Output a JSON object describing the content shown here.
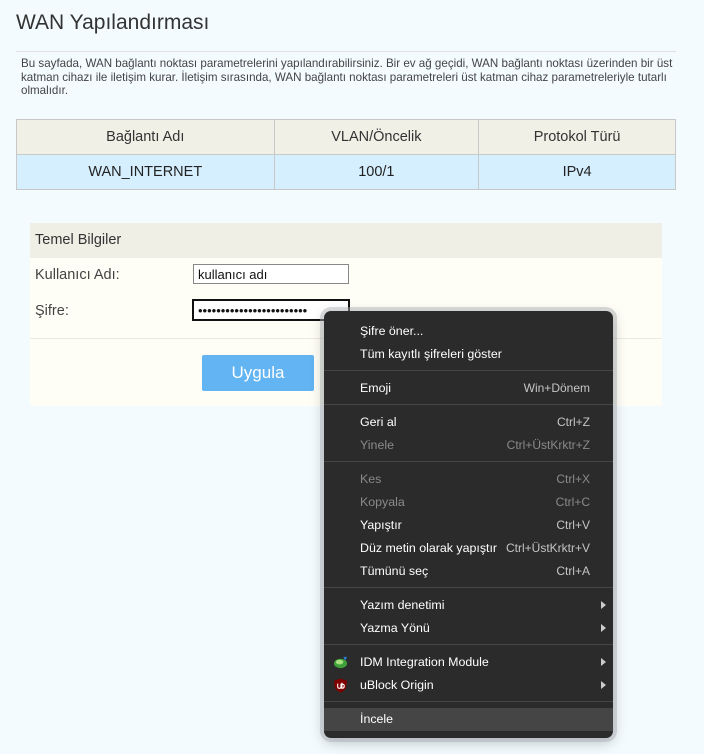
{
  "page": {
    "title": "WAN Yapılandırması",
    "description": "Bu sayfada, WAN bağlantı noktası parametrelerini yapılandırabilirsiniz. Bir ev ağ geçidi, WAN bağlantı noktası üzerinden bir üst katman cihazı ile iletişim kurar. İletişim sırasında, WAN bağlantı noktası parametreleri üst katman cihaz parametreleriyle tutarlı olmalıdır."
  },
  "wan_table": {
    "headers": [
      "Bağlantı Adı",
      "VLAN/Öncelik",
      "Protokol Türü"
    ],
    "rows": [
      [
        "WAN_INTERNET",
        "100/1",
        "IPv4"
      ]
    ]
  },
  "basic_info": {
    "header": "Temel Bilgiler",
    "username_label": "Kullanıcı Adı:",
    "username_value": "kullanıcı adı",
    "password_label": "Şifre:",
    "password_value": "passwordpasswordpassword",
    "apply_label": "Uygula"
  },
  "context_menu": {
    "items": [
      {
        "label": "Şifre öner...",
        "shortcut": "",
        "disabled": false,
        "submenu": false
      },
      {
        "label": "Tüm kayıtlı şifreleri göster",
        "shortcut": "",
        "disabled": false,
        "submenu": false
      },
      {
        "label": "Emoji",
        "shortcut": "Win+Dönem",
        "disabled": false,
        "submenu": false
      },
      {
        "label": "Geri al",
        "shortcut": "Ctrl+Z",
        "disabled": false,
        "submenu": false
      },
      {
        "label": "Yinele",
        "shortcut": "Ctrl+ÜstKrktr+Z",
        "disabled": true,
        "submenu": false
      },
      {
        "label": "Kes",
        "shortcut": "Ctrl+X",
        "disabled": true,
        "submenu": false
      },
      {
        "label": "Kopyala",
        "shortcut": "Ctrl+C",
        "disabled": true,
        "submenu": false
      },
      {
        "label": "Yapıştır",
        "shortcut": "Ctrl+V",
        "disabled": false,
        "submenu": false
      },
      {
        "label": "Düz metin olarak yapıştır",
        "shortcut": "Ctrl+ÜstKrktr+V",
        "disabled": false,
        "submenu": false
      },
      {
        "label": "Tümünü seç",
        "shortcut": "Ctrl+A",
        "disabled": false,
        "submenu": false
      },
      {
        "label": "Yazım denetimi",
        "shortcut": "",
        "disabled": false,
        "submenu": true
      },
      {
        "label": "Yazma Yönü",
        "shortcut": "",
        "disabled": false,
        "submenu": true
      },
      {
        "label": "IDM Integration Module",
        "shortcut": "",
        "disabled": false,
        "submenu": true,
        "icon": "idm-icon"
      },
      {
        "label": "uBlock Origin",
        "shortcut": "",
        "disabled": false,
        "submenu": true,
        "icon": "ublock-origin-icon"
      },
      {
        "label": "İncele",
        "shortcut": "",
        "disabled": false,
        "submenu": false,
        "highlighted": true
      }
    ]
  },
  "colors": {
    "page_bg": "#f3fbff",
    "table_header_bg": "#f1f0e6",
    "table_row_bg": "#d6efff",
    "apply_button_bg": "#62b4f2",
    "menu_bg": "#2b2b2b"
  }
}
